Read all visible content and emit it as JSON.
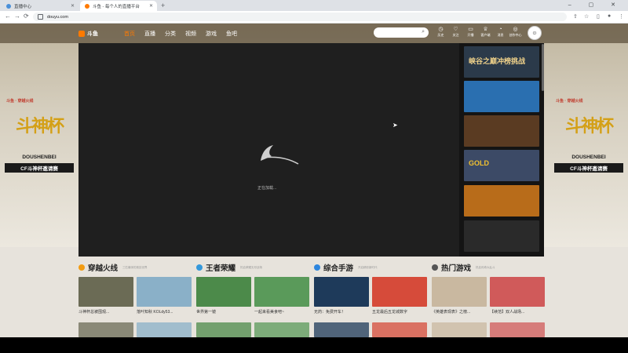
{
  "browser": {
    "tabs": [
      {
        "label": "直播中心",
        "favicon_color": "#4a90d9"
      },
      {
        "label": "斗鱼 - 每个人的直播平台",
        "favicon_color": "#ff7a00"
      }
    ],
    "new_tab": "+",
    "window_buttons": "– ▢ ✕",
    "url": "douyu.com",
    "nav_back": "←",
    "nav_forward": "→",
    "nav_reload": "⟳"
  },
  "header": {
    "logo_text": "斗鱼",
    "nav": [
      "首页",
      "直播",
      "分类",
      "视频",
      "游戏",
      "鱼吧"
    ],
    "search_placeholder": "",
    "icons": [
      {
        "glyph": "◷",
        "label": "历史"
      },
      {
        "glyph": "♡",
        "label": "关注"
      },
      {
        "glyph": "▭",
        "label": "开播"
      },
      {
        "glyph": "♕",
        "label": "客户端"
      },
      {
        "glyph": "◔",
        "label": "消息"
      },
      {
        "glyph": "◎",
        "label": "创作中心"
      }
    ],
    "avatar_glyph": "☺"
  },
  "side_promo": {
    "logos": "斗鱼 · 穿越火线",
    "big_text": "斗神杯",
    "name": "DOUSHENBEI",
    "cup": "CF斗神杯邀请赛"
  },
  "player": {
    "loading_text": "正在加载..."
  },
  "rail": [
    {
      "label": "峡谷之巅冲榜挑战",
      "bg": "#2b3a4a",
      "fg": "#f0d28a"
    },
    {
      "label": "",
      "bg": "#2a6fb0",
      "fg": "#fff"
    },
    {
      "label": "",
      "bg": "#5a3b22",
      "fg": "#f0c060"
    },
    {
      "label": "GOLD",
      "bg": "#3c4a66",
      "fg": "#f0c030"
    },
    {
      "label": "",
      "bg": "#b86c1a",
      "fg": "#fff"
    },
    {
      "label": "",
      "bg": "#2a2a2a",
      "fg": "#fff"
    }
  ],
  "sections": [
    {
      "title": "穿越火线",
      "subtitle": "三匹最帅的竞技世界",
      "icon_color": "#f39c12",
      "cards": [
        {
          "caption": "斗神杯总被围观...",
          "color": "#6b6b55"
        },
        {
          "caption": "落叶知秋 KOLdy53...",
          "color": "#8ab0c8"
        }
      ]
    },
    {
      "title": "王者荣耀",
      "subtitle": "热血荣耀无尽战场",
      "icon_color": "#3498db",
      "cards": [
        {
          "caption": "世界第一镜",
          "color": "#4c8a4a"
        },
        {
          "caption": "一起来看美食吧~",
          "color": "#5a9a5a"
        }
      ]
    },
    {
      "title": "综合手游",
      "subtitle": "开启精彩新时代",
      "icon_color": "#2e86de",
      "cards": [
        {
          "caption": "无药：免费开车！",
          "color": "#1e3a5a"
        },
        {
          "caption": "五龙最后五龙城数字",
          "color": "#d64b3a"
        }
      ]
    },
    {
      "title": "热门游戏",
      "subtitle": "热血传奇大乱斗",
      "icon_color": "#555555",
      "cards": [
        {
          "caption": "《英雄表现表》之榜...",
          "color": "#c9b8a0"
        },
        {
          "caption": "【续范】双人战场...",
          "color": "#d05a5a"
        }
      ]
    }
  ]
}
